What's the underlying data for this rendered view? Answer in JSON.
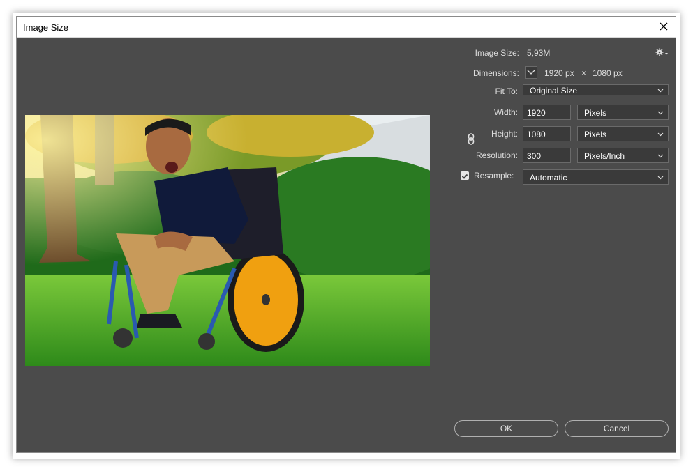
{
  "window": {
    "title": "Image Size"
  },
  "info": {
    "image_size_label": "Image Size:",
    "image_size_value": "5,93M",
    "dimensions_label": "Dimensions:",
    "dim_width": "1920 px",
    "dim_times": "×",
    "dim_height": "1080 px"
  },
  "fit_to": {
    "label": "Fit To:",
    "value": "Original Size"
  },
  "width": {
    "label": "Width:",
    "value": "1920",
    "unit": "Pixels"
  },
  "height": {
    "label": "Height:",
    "value": "1080",
    "unit": "Pixels"
  },
  "resolution": {
    "label": "Resolution:",
    "value": "300",
    "unit": "Pixels/Inch"
  },
  "resample": {
    "label": "Resample:",
    "checked": true,
    "value": "Automatic"
  },
  "buttons": {
    "ok": "OK",
    "cancel": "Cancel"
  },
  "colors": {
    "dialog_bg": "#4b4b4b",
    "field_bg": "#3a3a3a",
    "text": "#dcdcdc"
  }
}
